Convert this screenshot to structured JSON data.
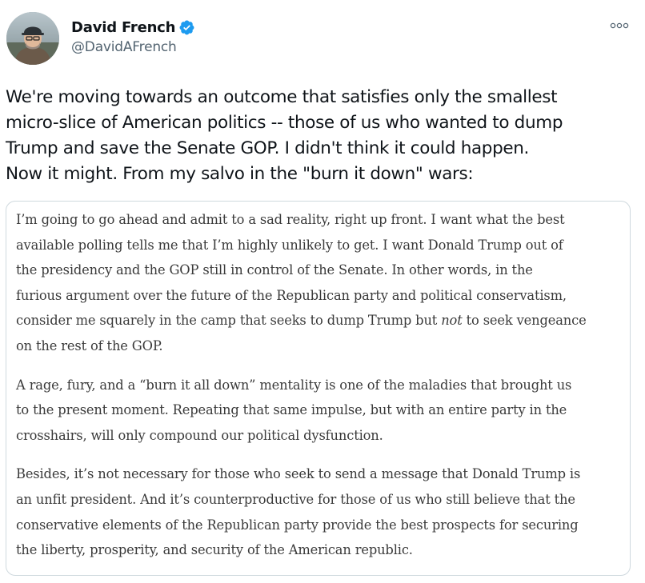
{
  "author": {
    "display_name": "David French",
    "handle": "@DavidAFrench",
    "verified": true,
    "verified_color": "#1d9bf0"
  },
  "tweet": {
    "text_lines": [
      "We're moving towards an outcome that satisfies only the smallest",
      "micro-slice of American politics -- those of us who wanted to dump",
      "Trump and save the Senate GOP. I didn't think it could happen.",
      "Now it might. From my salvo in the \"burn it down\" wars:"
    ]
  },
  "quote_image": {
    "paragraph1": [
      "I’m going to go ahead and admit to a sad reality, right up front. I want what the best",
      "available polling tells me that I’m highly unlikely to get. I want Donald Trump out of",
      "the presidency and the GOP still in control of the Senate. In other words, in the",
      "furious argument over the future of the Republican party and political conservatism,"
    ],
    "p1_line5_before": "consider me squarely in the camp that seeks to dump Trump but ",
    "p1_line5_em": "not",
    "p1_line5_after": " to seek vengeance",
    "p1_line6": "on the rest of the GOP.",
    "paragraph2": [
      "A rage, fury, and a “burn it all down” mentality is one of the maladies that brought us",
      "to the present moment. Repeating that same impulse, but with an entire party in the",
      "crosshairs, will only compound our political dysfunction."
    ],
    "paragraph3": [
      "Besides, it’s not necessary for those who seek to send a message that Donald Trump is",
      "an unfit president. And it’s counterproductive for those of us who still believe that the",
      "conservative elements of the Republican party provide the best prospects for securing",
      "the liberty, prosperity, and security of the American republic."
    ]
  },
  "icons": {
    "more": "more-horizontal-icon",
    "verified": "verified-badge-icon"
  }
}
